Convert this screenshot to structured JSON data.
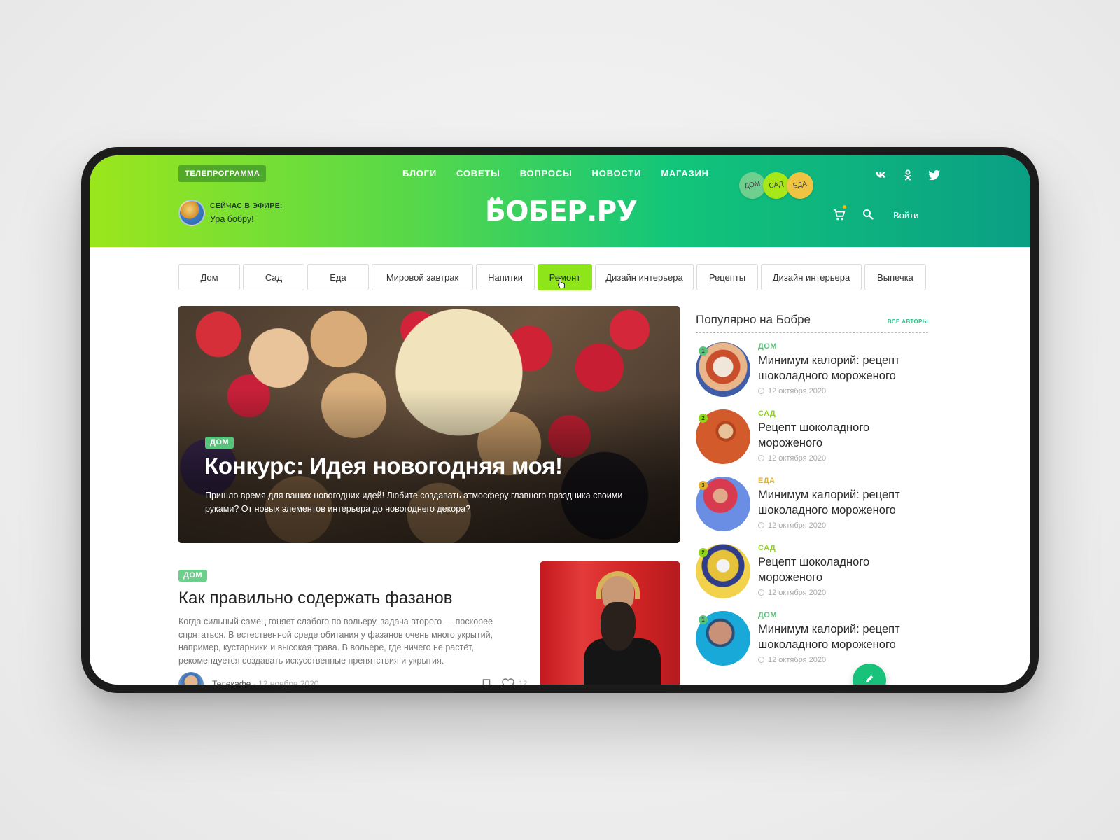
{
  "header": {
    "tv_badge": "ТЕЛЕПРОГРАММА",
    "nav": [
      "БЛОГИ",
      "СОВЕТЫ",
      "ВОПРОСЫ",
      "НОВОСТИ",
      "МАГАЗИН"
    ],
    "bubbles": [
      "ДОМ",
      "САД",
      "ЕДА"
    ],
    "on_air_label": "СЕЙЧАС В ЭФИРЕ:",
    "on_air_title": "Ура бобру!",
    "logo": "БОБЕР.РУ",
    "login": "Войти",
    "social_icons": [
      "vk-icon",
      "odnoklassniki-icon",
      "twitter-icon"
    ]
  },
  "categories": {
    "items": [
      "Дом",
      "Сад",
      "Еда",
      "Мировой завтрак",
      "Напитки",
      "Ремонт",
      "Дизайн интерьера",
      "Рецепты",
      "Дизайн интерьера",
      "Выпечка"
    ],
    "active": "Ремонт"
  },
  "hero": {
    "tag": "ДОМ",
    "title": "Конкурс: Идея новогодняя моя!",
    "description": "Пришло время для ваших новогодних идей! Любите создавать атмосферу главного праздника своими руками? От новых элементов интерьера до новогоднего декора?"
  },
  "article": {
    "tag": "ДОМ",
    "title": "Как правильно содержать фазанов",
    "description": "Когда сильный самец гоняет слабого по вольеру, задача второго — поскорее спрятаться. В естественной среде обитания у фазанов очень много укрытий, например, кустарники и высокая трава. В вольере, где ничего не растёт, рекомендуется создавать искусственные препятствия и укрытия.",
    "author": "Телекафе",
    "date": "· 12 ноября 2020",
    "likes": "12"
  },
  "popular": {
    "title": "Популярно на Бобре",
    "all_authors": "ВСЕ АВТОРЫ",
    "items": [
      {
        "rank": "1",
        "category": "ДОМ",
        "title": "Минимум калорий: рецепт шоколадного мороженого",
        "date": "12 октября 2020"
      },
      {
        "rank": "2",
        "category": "САД",
        "title": "Рецепт шоколадного мороженого",
        "date": "12 октября 2020"
      },
      {
        "rank": "3",
        "category": "ЕДА",
        "title": "Минимум калорий: рецепт шоколадного мороженого",
        "date": "12 октября 2020"
      },
      {
        "rank": "2",
        "category": "САД",
        "title": "Рецепт шоколадного мороженого",
        "date": "12 октября 2020"
      },
      {
        "rank": "1",
        "category": "ДОМ",
        "title": "Минимум калорий: рецепт шоколадного мороженого",
        "date": "12 октября 2020"
      }
    ]
  },
  "colors": {
    "accent_green": "#8ee519",
    "brand_teal": "#12c57a",
    "cat_dom": "#56c47a",
    "cat_sad": "#8fd61a",
    "cat_eda": "#e2b22c"
  }
}
